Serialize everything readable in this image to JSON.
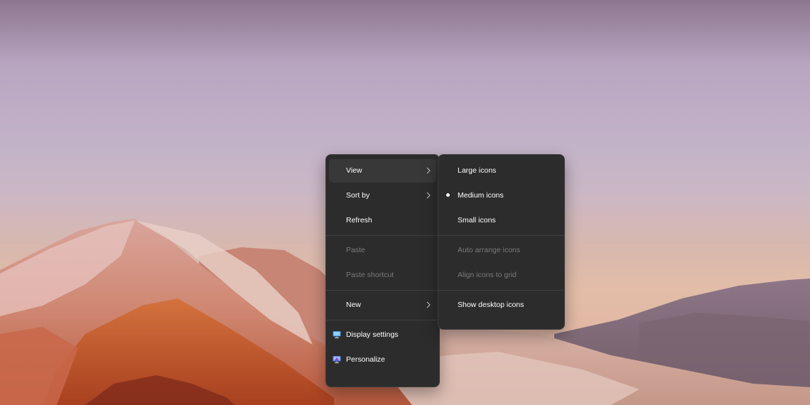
{
  "main_menu": {
    "items": [
      {
        "label": "View",
        "has_submenu": true,
        "enabled": true,
        "highlighted": true
      },
      {
        "label": "Sort by",
        "has_submenu": true,
        "enabled": true
      },
      {
        "label": "Refresh",
        "enabled": true
      },
      {
        "label": "Paste",
        "enabled": false
      },
      {
        "label": "Paste shortcut",
        "enabled": false
      },
      {
        "label": "New",
        "has_submenu": true,
        "enabled": true
      },
      {
        "label": "Display settings",
        "icon": "display-settings-icon",
        "enabled": true
      },
      {
        "label": "Personalize",
        "icon": "personalize-icon",
        "enabled": true
      }
    ]
  },
  "view_submenu": {
    "items": [
      {
        "label": "Large icons",
        "enabled": true
      },
      {
        "label": "Medium icons",
        "enabled": true,
        "selected": true
      },
      {
        "label": "Small icons",
        "enabled": true
      },
      {
        "label": "Auto arrange icons",
        "enabled": false
      },
      {
        "label": "Align icons to grid",
        "enabled": false
      },
      {
        "label": "Show desktop icons",
        "enabled": true
      }
    ]
  },
  "colors": {
    "menu_background": "#2c2c2c",
    "highlight": "#383838",
    "disabled_text": "#7a7a7a",
    "text": "#ffffff"
  }
}
